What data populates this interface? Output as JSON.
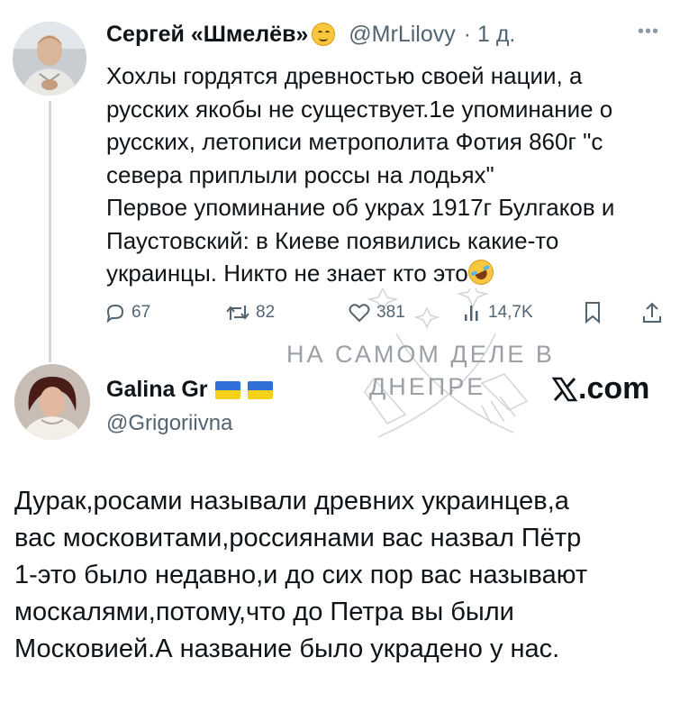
{
  "tweet1": {
    "name": "Сергей «Шмелёв»",
    "handle": "@MrLilovy",
    "time": "· 1 д.",
    "body": "Хохлы гордятся древностью своей нации, а\nрусских якобы не существует.1е упоминание о\nрусских, летописи метрополита Фотия 860г \"с\nсевера приплыли россы на лодьях\"\nПервое упоминание об украх 1917г Булгаков и\nПаустовский: в Киеве появились какие-то\nукраинцы. Никто не знает кто это",
    "emoji_icon": "upside-down-face-icon",
    "trailing_emoji_icon": "rolling-on-floor-laughing-icon",
    "actions": {
      "replies": "67",
      "reposts": "82",
      "likes": "381",
      "views": "14,7K"
    }
  },
  "watermark": {
    "line1": "НА САМОМ ДЕЛЕ В",
    "line2": "ДНЕПРЕ",
    "site": ".com"
  },
  "tweet2": {
    "name": "Galina Gr",
    "handle": "@Grigoriivna",
    "flags": [
      "ukraine-flag-icon",
      "ukraine-flag-icon"
    ],
    "body": "Дурак,росами называли древних украинцев,а\nвас московитами,россиянами вас назвал Пётр\n1-это было недавно,и до сих пор вас называют\nмоскалями,потому,что до Петра вы были\nМосковией.А название было украдено у нас."
  },
  "colors": {
    "text": "#0f1419",
    "secondary": "#536471",
    "thread_line": "#cfd9de",
    "flag_blue": "#2f6fd8",
    "flag_yellow": "#f7d117"
  }
}
